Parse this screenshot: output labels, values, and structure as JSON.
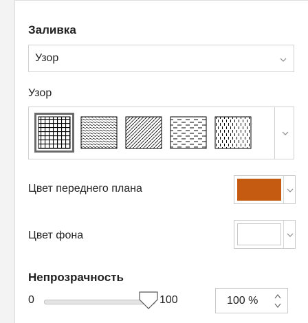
{
  "fill": {
    "title": "Заливка",
    "type_value": "Узор"
  },
  "pattern": {
    "label": "Узор",
    "swatches": [
      {
        "name": "grid",
        "selected": true
      },
      {
        "name": "wide-downward-diagonal",
        "selected": false
      },
      {
        "name": "wide-upward-diagonal",
        "selected": false
      },
      {
        "name": "dashed-horizontal",
        "selected": false
      },
      {
        "name": "dashed-vertical",
        "selected": false
      }
    ]
  },
  "foreground": {
    "label": "Цвет переднего плана",
    "color": "#C55A11"
  },
  "background": {
    "label": "Цвет фона",
    "color": "#FFFFFF"
  },
  "opacity": {
    "title": "Непрозрачность",
    "min_label": "0",
    "max_label": "100",
    "value": 100,
    "value_text": "100 %"
  }
}
